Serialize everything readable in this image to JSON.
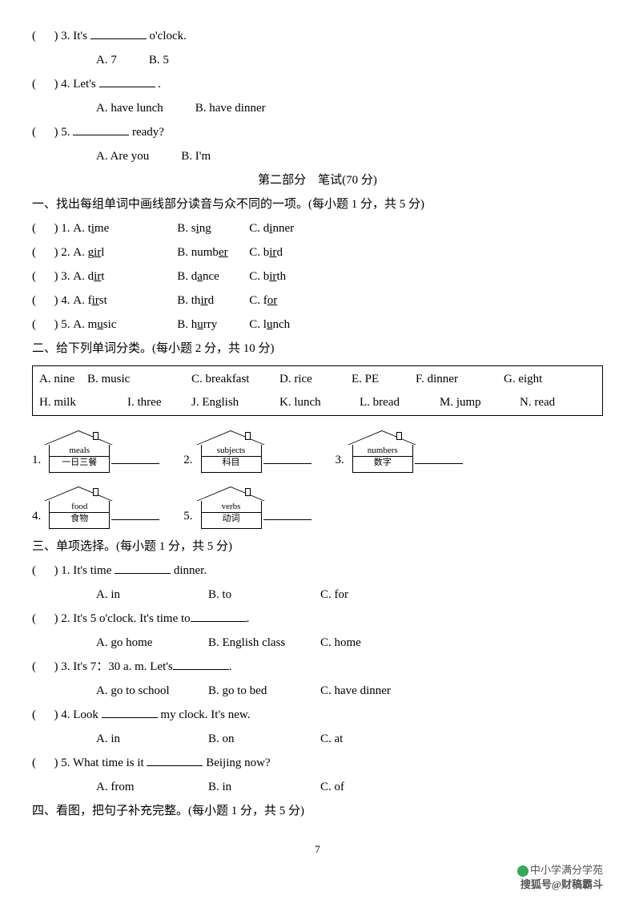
{
  "listening_qs": [
    {
      "num": "3",
      "stem_a": "It's",
      "stem_b": "o'clock.",
      "opts": [
        "A. 7",
        "B. 5"
      ]
    },
    {
      "num": "4",
      "stem_a": "Let's",
      "stem_b": ".",
      "opts": [
        "A. have lunch",
        "B. have dinner"
      ]
    },
    {
      "num": "5",
      "stem_a": "",
      "stem_b": "ready?",
      "opts": [
        "A. Are you",
        "B. I'm"
      ]
    }
  ],
  "part2_title": "第二部分　笔试(70 分)",
  "sec1": {
    "title": "一、找出每组单词中画线部分读音与众不同的一项。(每小题 1 分，共 5 分)",
    "rows": [
      {
        "num": "1",
        "a_pre": "A. t",
        "a_u": "i",
        "a_post": "me",
        "b_pre": "B. s",
        "b_u": "i",
        "b_post": "ng",
        "c_pre": "C. d",
        "c_u": "i",
        "c_post": "nner"
      },
      {
        "num": "2",
        "a_pre": "A. g",
        "a_u": "ir",
        "a_post": "l",
        "b_pre": "B. numb",
        "b_u": "er",
        "b_post": "",
        "c_pre": "C. b",
        "c_u": "ir",
        "c_post": "d"
      },
      {
        "num": "3",
        "a_pre": "A. d",
        "a_u": "ir",
        "a_post": "t",
        "b_pre": "B. d",
        "b_u": "a",
        "b_post": "nce",
        "c_pre": "C. b",
        "c_u": "ir",
        "c_post": "th"
      },
      {
        "num": "4",
        "a_pre": "A. f",
        "a_u": "ir",
        "a_post": "st",
        "b_pre": "B. th",
        "b_u": "ir",
        "b_post": "d",
        "c_pre": "C. f",
        "c_u": "or",
        "c_post": ""
      },
      {
        "num": "5",
        "a_pre": "A. m",
        "a_u": "u",
        "a_post": "sic",
        "b_pre": "B. h",
        "b_u": "u",
        "b_post": "rry",
        "c_pre": "C. l",
        "c_u": "u",
        "c_post": "nch"
      }
    ]
  },
  "sec2": {
    "title": "二、给下列单词分类。(每小题 2 分，共 10 分)",
    "box_row1": [
      "A. nine",
      "B. music",
      "C. breakfast",
      "D. rice",
      "E. PE",
      "F. dinner",
      "G. eight"
    ],
    "box_row2": [
      "H. milk",
      "I. three",
      "J. English",
      "K. lunch",
      "L. bread",
      "M. jump",
      "N. read"
    ],
    "houses": [
      {
        "num": "1.",
        "en": "meals",
        "cn": "一日三餐"
      },
      {
        "num": "2.",
        "en": "subjects",
        "cn": "科目"
      },
      {
        "num": "3.",
        "en": "numbers",
        "cn": "数字"
      },
      {
        "num": "4.",
        "en": "food",
        "cn": "食物"
      },
      {
        "num": "5.",
        "en": "verbs",
        "cn": "动词"
      }
    ]
  },
  "sec3": {
    "title": "三、单项选择。(每小题 1 分，共 5 分)",
    "qs": [
      {
        "num": "1",
        "pre": "It's time ",
        "post": " dinner.",
        "opts": [
          "A. in",
          "B. to",
          "C. for"
        ]
      },
      {
        "num": "2",
        "pre": "It's 5 o'clock. It's time to",
        "post": ".",
        "opts": [
          "A. go home",
          "B. English class",
          "C. home"
        ]
      },
      {
        "num": "3",
        "pre": "It's 7：30 a. m. Let's",
        "post": ".",
        "opts": [
          "A. go to school",
          "B. go to bed",
          "C. have dinner"
        ]
      },
      {
        "num": "4",
        "pre": "Look ",
        "post": " my clock. It's new.",
        "opts": [
          "A. in",
          "B. on",
          "C. at"
        ]
      },
      {
        "num": "5",
        "pre": "What time is it ",
        "post": " Beijing now?",
        "opts": [
          "A. from",
          "B. in",
          "C. of"
        ]
      }
    ]
  },
  "sec4_title": "四、看图，把句子补充完整。(每小题 1 分，共 5 分)",
  "page_num": "7",
  "watermark1": "中小学满分学苑",
  "watermark2": "搜狐号@财稿霸斗"
}
